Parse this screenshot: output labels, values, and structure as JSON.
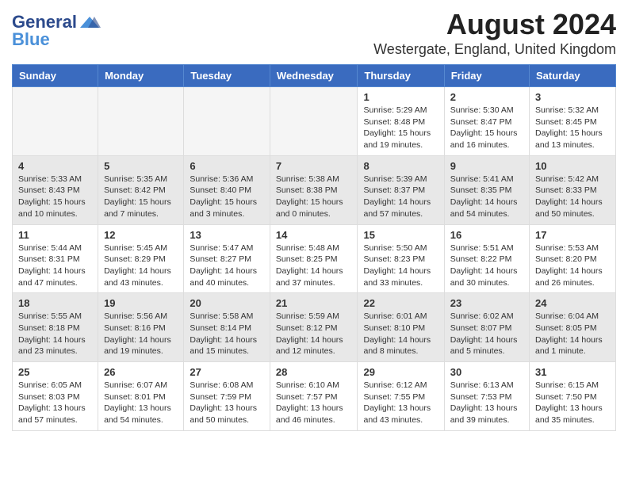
{
  "header": {
    "logo_general": "General",
    "logo_blue": "Blue",
    "title": "August 2024",
    "subtitle": "Westergate, England, United Kingdom"
  },
  "days_of_week": [
    "Sunday",
    "Monday",
    "Tuesday",
    "Wednesday",
    "Thursday",
    "Friday",
    "Saturday"
  ],
  "weeks": [
    [
      {
        "day": "",
        "info": ""
      },
      {
        "day": "",
        "info": ""
      },
      {
        "day": "",
        "info": ""
      },
      {
        "day": "",
        "info": ""
      },
      {
        "day": "1",
        "info": "Sunrise: 5:29 AM\nSunset: 8:48 PM\nDaylight: 15 hours\nand 19 minutes."
      },
      {
        "day": "2",
        "info": "Sunrise: 5:30 AM\nSunset: 8:47 PM\nDaylight: 15 hours\nand 16 minutes."
      },
      {
        "day": "3",
        "info": "Sunrise: 5:32 AM\nSunset: 8:45 PM\nDaylight: 15 hours\nand 13 minutes."
      }
    ],
    [
      {
        "day": "4",
        "info": "Sunrise: 5:33 AM\nSunset: 8:43 PM\nDaylight: 15 hours\nand 10 minutes."
      },
      {
        "day": "5",
        "info": "Sunrise: 5:35 AM\nSunset: 8:42 PM\nDaylight: 15 hours\nand 7 minutes."
      },
      {
        "day": "6",
        "info": "Sunrise: 5:36 AM\nSunset: 8:40 PM\nDaylight: 15 hours\nand 3 minutes."
      },
      {
        "day": "7",
        "info": "Sunrise: 5:38 AM\nSunset: 8:38 PM\nDaylight: 15 hours\nand 0 minutes."
      },
      {
        "day": "8",
        "info": "Sunrise: 5:39 AM\nSunset: 8:37 PM\nDaylight: 14 hours\nand 57 minutes."
      },
      {
        "day": "9",
        "info": "Sunrise: 5:41 AM\nSunset: 8:35 PM\nDaylight: 14 hours\nand 54 minutes."
      },
      {
        "day": "10",
        "info": "Sunrise: 5:42 AM\nSunset: 8:33 PM\nDaylight: 14 hours\nand 50 minutes."
      }
    ],
    [
      {
        "day": "11",
        "info": "Sunrise: 5:44 AM\nSunset: 8:31 PM\nDaylight: 14 hours\nand 47 minutes."
      },
      {
        "day": "12",
        "info": "Sunrise: 5:45 AM\nSunset: 8:29 PM\nDaylight: 14 hours\nand 43 minutes."
      },
      {
        "day": "13",
        "info": "Sunrise: 5:47 AM\nSunset: 8:27 PM\nDaylight: 14 hours\nand 40 minutes."
      },
      {
        "day": "14",
        "info": "Sunrise: 5:48 AM\nSunset: 8:25 PM\nDaylight: 14 hours\nand 37 minutes."
      },
      {
        "day": "15",
        "info": "Sunrise: 5:50 AM\nSunset: 8:23 PM\nDaylight: 14 hours\nand 33 minutes."
      },
      {
        "day": "16",
        "info": "Sunrise: 5:51 AM\nSunset: 8:22 PM\nDaylight: 14 hours\nand 30 minutes."
      },
      {
        "day": "17",
        "info": "Sunrise: 5:53 AM\nSunset: 8:20 PM\nDaylight: 14 hours\nand 26 minutes."
      }
    ],
    [
      {
        "day": "18",
        "info": "Sunrise: 5:55 AM\nSunset: 8:18 PM\nDaylight: 14 hours\nand 23 minutes."
      },
      {
        "day": "19",
        "info": "Sunrise: 5:56 AM\nSunset: 8:16 PM\nDaylight: 14 hours\nand 19 minutes."
      },
      {
        "day": "20",
        "info": "Sunrise: 5:58 AM\nSunset: 8:14 PM\nDaylight: 14 hours\nand 15 minutes."
      },
      {
        "day": "21",
        "info": "Sunrise: 5:59 AM\nSunset: 8:12 PM\nDaylight: 14 hours\nand 12 minutes."
      },
      {
        "day": "22",
        "info": "Sunrise: 6:01 AM\nSunset: 8:10 PM\nDaylight: 14 hours\nand 8 minutes."
      },
      {
        "day": "23",
        "info": "Sunrise: 6:02 AM\nSunset: 8:07 PM\nDaylight: 14 hours\nand 5 minutes."
      },
      {
        "day": "24",
        "info": "Sunrise: 6:04 AM\nSunset: 8:05 PM\nDaylight: 14 hours\nand 1 minute."
      }
    ],
    [
      {
        "day": "25",
        "info": "Sunrise: 6:05 AM\nSunset: 8:03 PM\nDaylight: 13 hours\nand 57 minutes."
      },
      {
        "day": "26",
        "info": "Sunrise: 6:07 AM\nSunset: 8:01 PM\nDaylight: 13 hours\nand 54 minutes."
      },
      {
        "day": "27",
        "info": "Sunrise: 6:08 AM\nSunset: 7:59 PM\nDaylight: 13 hours\nand 50 minutes."
      },
      {
        "day": "28",
        "info": "Sunrise: 6:10 AM\nSunset: 7:57 PM\nDaylight: 13 hours\nand 46 minutes."
      },
      {
        "day": "29",
        "info": "Sunrise: 6:12 AM\nSunset: 7:55 PM\nDaylight: 13 hours\nand 43 minutes."
      },
      {
        "day": "30",
        "info": "Sunrise: 6:13 AM\nSunset: 7:53 PM\nDaylight: 13 hours\nand 39 minutes."
      },
      {
        "day": "31",
        "info": "Sunrise: 6:15 AM\nSunset: 7:50 PM\nDaylight: 13 hours\nand 35 minutes."
      }
    ]
  ]
}
